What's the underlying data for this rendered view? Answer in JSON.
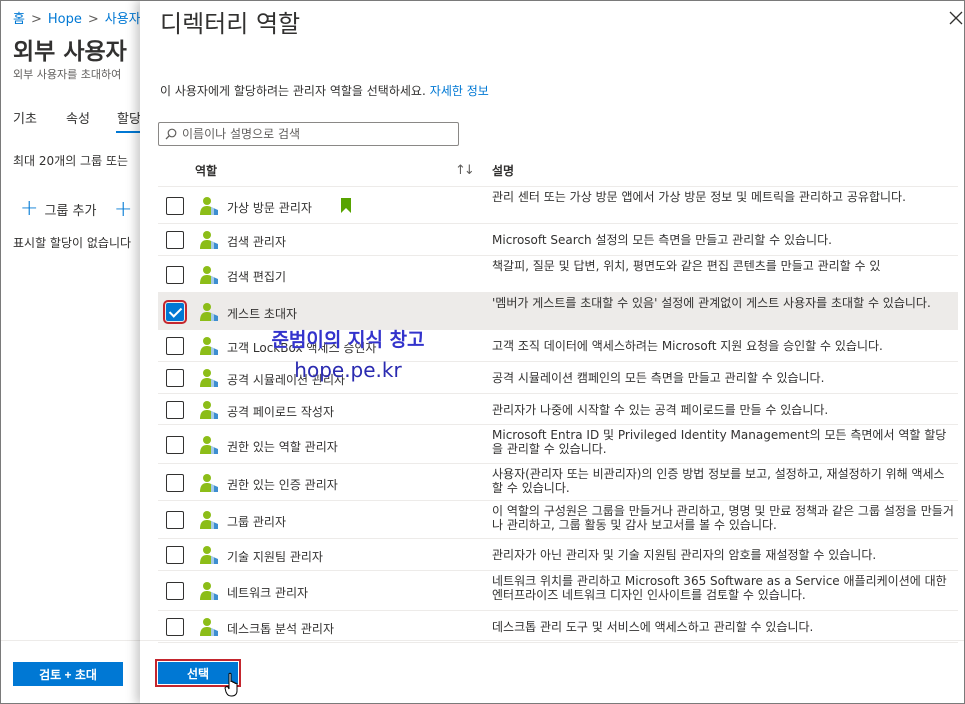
{
  "background": {
    "breadcrumb": [
      "홈",
      "Hope",
      "사용자"
    ],
    "title": "외부 사용자",
    "subtitle": "외부 사용자를 초대하여",
    "tabs": [
      "기초",
      "속성",
      "할당"
    ],
    "info_text": "최대 20개의 그룹 또는",
    "add_group_label": "그룹 추가",
    "empty_text": "표시할 할당이 없습니다",
    "review_button_label": "검토 + 초대"
  },
  "panel": {
    "title": "디렉터리 역할",
    "description": "이 사용자에게 할당하려는 관리자 역할을 선택하세요.",
    "learn_more_link": "자세한 정보",
    "search_placeholder": "이름이나 설명으로 검색",
    "columns": {
      "role": "역할",
      "sort_icon": "↑↓",
      "description": "설명"
    },
    "select_button_label": "선택",
    "rows": [
      {
        "role": "가상 방문 관리자",
        "description": "관리 센터 또는 가상 방문 앱에서 가상 방문 정보 및 메트릭을 관리하고 공유합니다.",
        "checked": false,
        "bookmark": true
      },
      {
        "role": "검색 관리자",
        "description": "Microsoft Search 설정의 모든 측면을 만들고 관리할 수 있습니다.",
        "checked": false,
        "bookmark": false
      },
      {
        "role": "검색 편집기",
        "description": "책갈피, 질문 및 답변, 위치, 평면도와 같은 편집 콘텐츠를 만들고 관리할 수 있",
        "checked": false,
        "bookmark": false
      },
      {
        "role": "게스트 초대자",
        "description": "'멤버가 게스트를 초대할 수 있음' 설정에 관계없이 게스트 사용자를 초대할 수 있습니다.",
        "checked": true,
        "bookmark": false
      },
      {
        "role": "고객 LockBox 액세스 승인자",
        "description": "고객 조직 데이터에 액세스하려는 Microsoft 지원 요청을 승인할 수 있습니다.",
        "checked": false,
        "bookmark": false
      },
      {
        "role": "공격 시뮬레이션 관리자",
        "description": "공격 시뮬레이션 캠페인의 모든 측면을 만들고 관리할 수 있습니다.",
        "checked": false,
        "bookmark": false
      },
      {
        "role": "공격 페이로드 작성자",
        "description": "관리자가 나중에 시작할 수 있는 공격 페이로드를 만들 수 있습니다.",
        "checked": false,
        "bookmark": false
      },
      {
        "role": "권한 있는 역할 관리자",
        "description": "Microsoft Entra ID 및 Privileged Identity Management의 모든 측면에서 역할 할당을 관리할 수 있습니다.",
        "checked": false,
        "bookmark": false
      },
      {
        "role": "권한 있는 인증 관리자",
        "description": "사용자(관리자 또는 비관리자)의 인증 방법 정보를 보고, 설정하고, 재설정하기 위해 액세스할 수 있습니다.",
        "checked": false,
        "bookmark": false
      },
      {
        "role": "그룹 관리자",
        "description": "이 역할의 구성원은 그룹을 만들거나 관리하고, 명명 및 만료 정책과 같은 그룹 설정을 만들거나 관리하고, 그룹 활동 및 감사 보고서를 볼 수 있습니다.",
        "checked": false,
        "bookmark": false
      },
      {
        "role": "기술 지원팀 관리자",
        "description": "관리자가 아닌 관리자 및 기술 지원팀 관리자의 암호를 재설정할 수 있습니다.",
        "checked": false,
        "bookmark": false
      },
      {
        "role": "네트워크 관리자",
        "description": "네트워크 위치를 관리하고 Microsoft 365 Software as a Service 애플리케이션에 대한 엔터프라이즈 네트워크 디자인 인사이트를 검토할 수 있습니다.",
        "checked": false,
        "bookmark": false
      },
      {
        "role": "데스크톱 분석 관리자",
        "description": "데스크톱 관리 도구 및 서비스에 액세스하고 관리할 수 있습니다.",
        "checked": false,
        "bookmark": false
      }
    ]
  },
  "watermark": {
    "line1": "준범이의 지식 창고",
    "line2": "hope.pe.kr"
  },
  "colors": {
    "accent": "#0078d4",
    "highlight_outline": "#c4262e",
    "role_icon_green": "#8cbd18",
    "role_icon_blue": "#3e8ed0",
    "bookmark_green": "#57a300"
  }
}
